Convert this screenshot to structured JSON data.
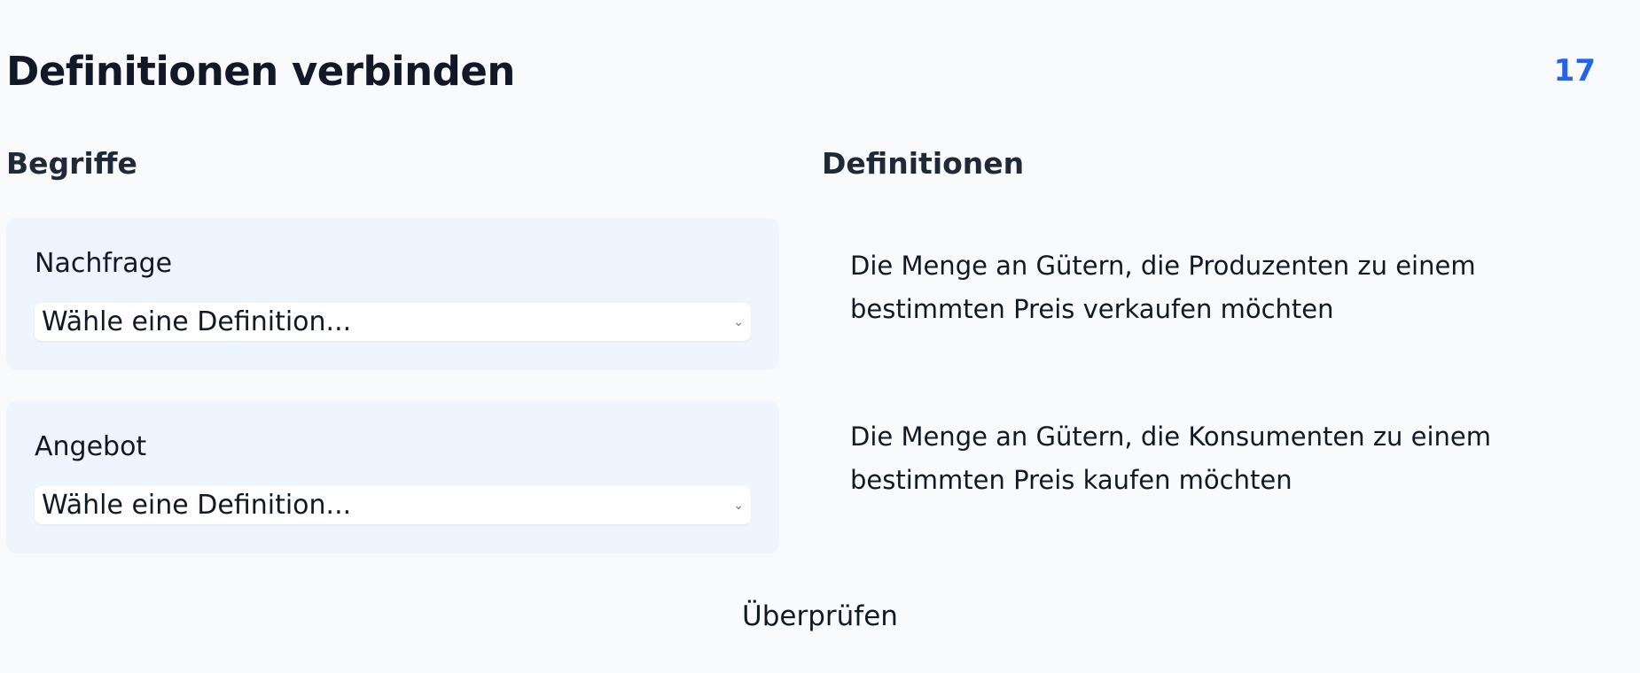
{
  "header": {
    "title": "Definitionen verbinden",
    "score": "17"
  },
  "terms": {
    "heading": "Begriffe",
    "items": [
      {
        "label": "Nachfrage",
        "select_value": "Wähle eine Definition..."
      },
      {
        "label": "Angebot",
        "select_value": "Wähle eine Definition..."
      }
    ]
  },
  "definitions": {
    "heading": "Definitionen",
    "items": [
      "Die Menge an Gütern, die Produzenten zu einem bestimmten Preis verkaufen möchten",
      "Die Menge an Gütern, die Konsumenten zu einem bestimmten Preis kaufen möchten"
    ]
  },
  "actions": {
    "check_label": "Überprüfen"
  },
  "colors": {
    "accent": "#2563eb",
    "card_background": "#eef5fe",
    "page_background": "#f8fafc"
  },
  "icons": {
    "select_chevron": "chevron-down-icon"
  }
}
